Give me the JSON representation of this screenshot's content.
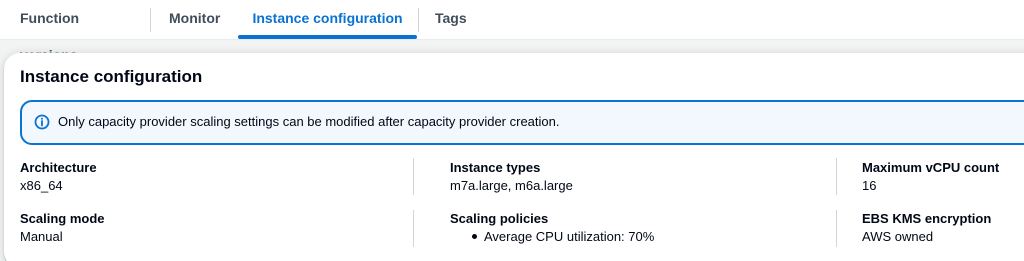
{
  "tabs": [
    {
      "label": "Function versions"
    },
    {
      "label": "Monitor"
    },
    {
      "label": "Instance configuration"
    },
    {
      "label": "Tags"
    }
  ],
  "active_tab": "Instance configuration",
  "panel": {
    "title": "Instance configuration",
    "alert": {
      "icon": "info-icon",
      "text": "Only capacity provider scaling settings can be modified after capacity provider creation."
    },
    "fields": {
      "architecture": {
        "label": "Architecture",
        "value": "x86_64"
      },
      "instance_types": {
        "label": "Instance types",
        "value": "m7a.large, m6a.large"
      },
      "max_vcpu": {
        "label": "Maximum vCPU count",
        "value": "16"
      },
      "scaling_mode": {
        "label": "Scaling mode",
        "value": "Manual"
      },
      "scaling_policies": {
        "label": "Scaling policies",
        "items": [
          "Average CPU utilization: 70%"
        ]
      },
      "ebs_kms": {
        "label": "EBS KMS encryption",
        "value": "AWS owned"
      }
    }
  },
  "colors": {
    "accent": "#0972d3",
    "alert_bg": "#f2f8fd",
    "text": "#000716",
    "muted_tab": "#414d5c"
  }
}
